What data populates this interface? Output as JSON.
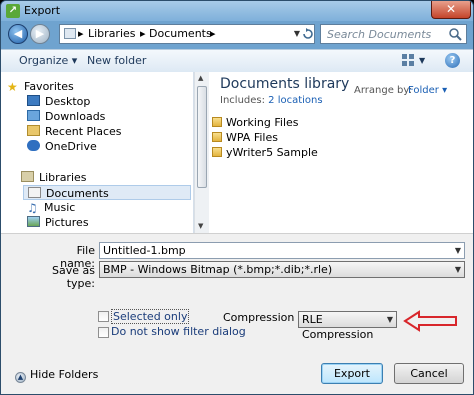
{
  "window": {
    "title": "Export",
    "close_glyph": "✕"
  },
  "nav": {
    "breadcrumb": [
      "Libraries",
      "Documents"
    ],
    "search_placeholder": "Search Documents"
  },
  "toolbar": {
    "organize": "Organize ▾",
    "new_folder": "New folder"
  },
  "sidebar": {
    "favorites_label": "Favorites",
    "favorites": [
      "Desktop",
      "Downloads",
      "Recent Places",
      "OneDrive"
    ],
    "libraries_label": "Libraries",
    "libraries": [
      "Documents",
      "Music",
      "Pictures"
    ]
  },
  "content": {
    "title": "Documents library",
    "includes_label": "Includes:",
    "includes_link": "2 locations",
    "arrange_label": "Arrange by:",
    "arrange_value": "Folder ▾",
    "folders": [
      "Working Files",
      "WPA Files",
      "yWriter5 Sample"
    ]
  },
  "form": {
    "filename_label": "File name:",
    "filename_value": "Untitled-1.bmp",
    "savetype_label": "Save as type:",
    "savetype_value": "BMP - Windows Bitmap (*.bmp;*.dib;*.rle)",
    "selected_only": "Selected only",
    "no_filter_dialog": "Do not show filter dialog",
    "compression_label": "Compression type",
    "compression_value": "RLE Compression",
    "hide_folders": "Hide Folders",
    "export_btn": "Export",
    "cancel_btn": "Cancel"
  },
  "colors": {
    "annotation_arrow": "#d8262b",
    "selection": "#dfeaf6"
  }
}
